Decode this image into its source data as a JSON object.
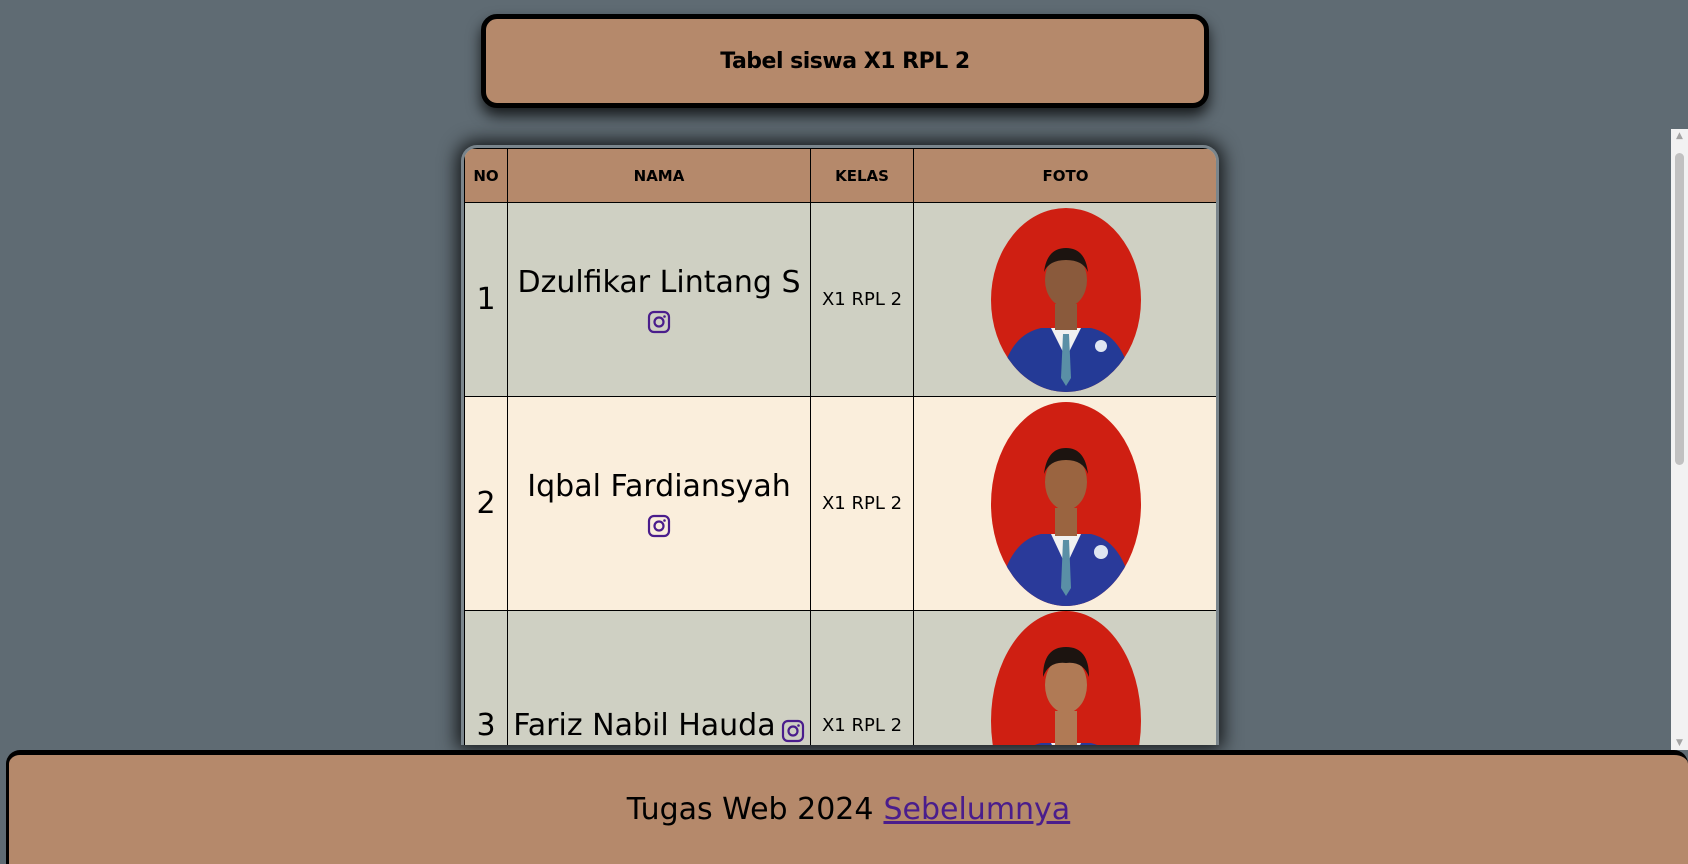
{
  "header": {
    "title": "Tabel siswa X1 RPL 2"
  },
  "table": {
    "columns": [
      "NO",
      "NAMA",
      "KELAS",
      "FOTO"
    ],
    "rows": [
      {
        "no": "1",
        "nama": "Dzulfikar Lintang S",
        "kelas": "X1 RPL 2",
        "icon": "instagram-icon"
      },
      {
        "no": "2",
        "nama": "Iqbal Fardiansyah",
        "kelas": "X1 RPL 2",
        "icon": "instagram-icon"
      },
      {
        "no": "3",
        "nama": "Fariz Nabil Hauda",
        "kelas": "X1 RPL 2",
        "icon": "instagram-icon"
      }
    ]
  },
  "footer": {
    "text": "Tugas Web 2024",
    "link": "Sebelumnya"
  },
  "colors": {
    "accent": "#b5896b",
    "background": "#5f6b73",
    "row_gray": "#cfd0c3",
    "row_cream": "#faeedc",
    "link": "#4a1d8c"
  }
}
